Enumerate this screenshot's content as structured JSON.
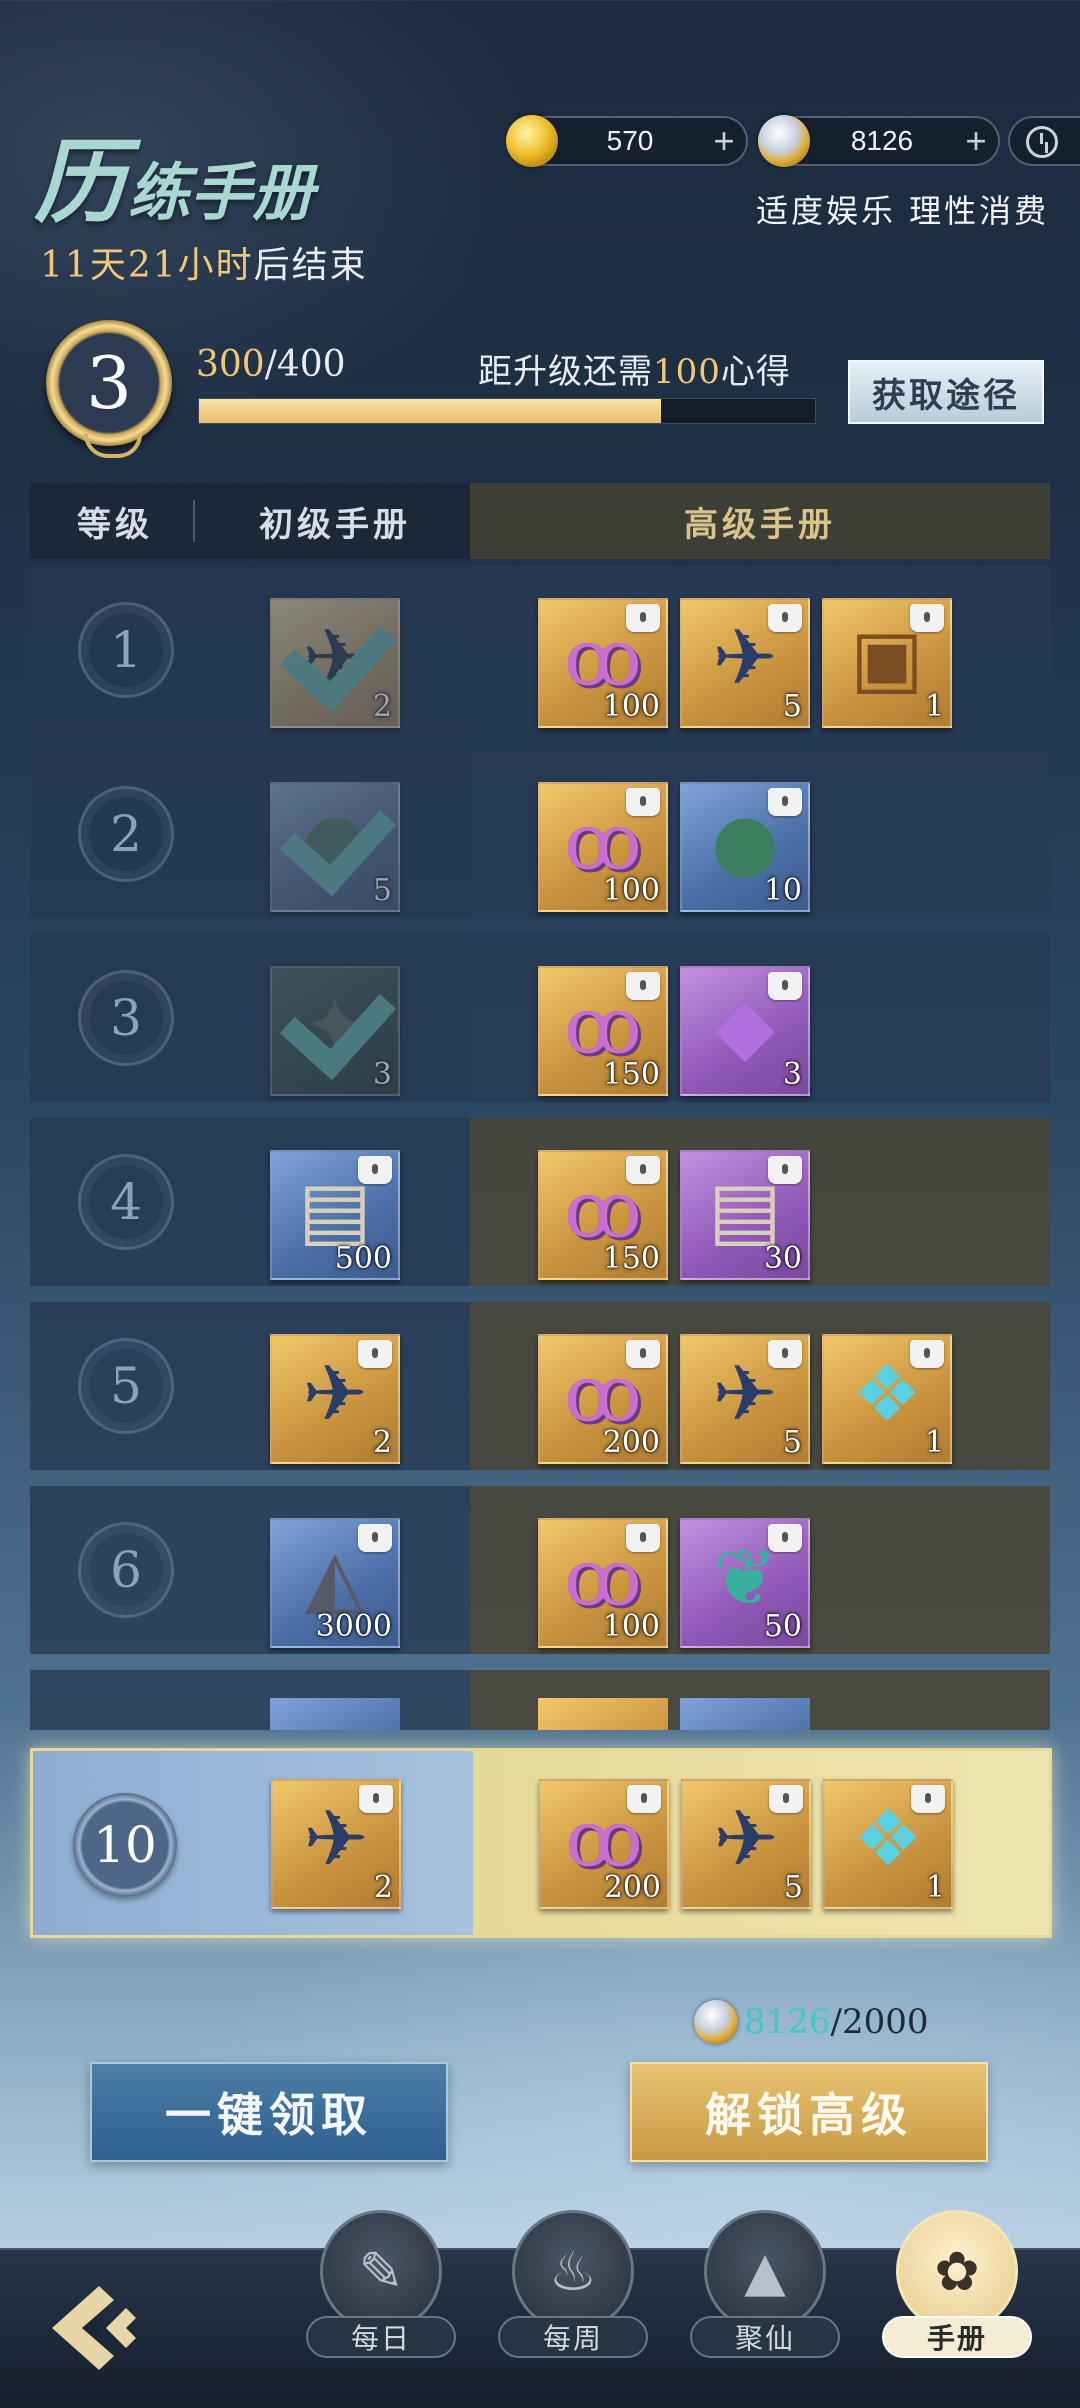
{
  "header": {
    "title_first": "历",
    "title_rest": "练手册",
    "countdown_days": "11",
    "countdown_days_unit": "天",
    "countdown_hours": "21",
    "countdown_hours_unit": "小时",
    "countdown_suffix": "后结束",
    "notice": "适度娱乐 理性消费"
  },
  "currencies": [
    {
      "icon": "gold-ingot-icon",
      "amount": "570",
      "plus": "+"
    },
    {
      "icon": "silver-gold-coin-icon",
      "amount": "8126",
      "plus": "+"
    }
  ],
  "progress": {
    "level": "3",
    "exp_current": "300",
    "exp_total": "/400",
    "need_prefix": "距升级还需",
    "need_amount": "100",
    "need_suffix": "心得",
    "fill_fraction": 0.75,
    "get_button": "获取途径"
  },
  "table_header": {
    "level": "等级",
    "basic": "初级手册",
    "advanced": "高级手册"
  },
  "rows": [
    {
      "level": "1",
      "claimed": true,
      "basic": [
        {
          "icon": "cannon-scroll-icon",
          "rarity": "gold",
          "count": "2",
          "claimed": true
        }
      ],
      "advanced": [
        {
          "icon": "spiral-token-icon",
          "rarity": "gold",
          "count": "100"
        },
        {
          "icon": "cannon-scroll-icon",
          "rarity": "gold",
          "count": "5"
        },
        {
          "icon": "treasure-chest-icon",
          "rarity": "gold",
          "count": "1"
        }
      ]
    },
    {
      "level": "2",
      "claimed": true,
      "basic": [
        {
          "icon": "herb-pouch-icon",
          "rarity": "blue",
          "count": "5",
          "claimed": true
        }
      ],
      "advanced": [
        {
          "icon": "spiral-token-icon",
          "rarity": "gold",
          "count": "100"
        },
        {
          "icon": "herb-pouch-icon",
          "rarity": "blue",
          "count": "10"
        }
      ]
    },
    {
      "level": "3",
      "claimed": true,
      "basic": [
        {
          "icon": "horn-icon",
          "rarity": "green",
          "count": "3",
          "claimed": true
        }
      ],
      "advanced": [
        {
          "icon": "spiral-token-icon",
          "rarity": "gold",
          "count": "150"
        },
        {
          "icon": "purple-crystal-icon",
          "rarity": "purple",
          "count": "3"
        }
      ]
    },
    {
      "level": "4",
      "claimed": false,
      "basic": [
        {
          "icon": "paper-scroll-icon",
          "rarity": "blue",
          "count": "500"
        }
      ],
      "advanced": [
        {
          "icon": "spiral-token-icon",
          "rarity": "gold",
          "count": "150"
        },
        {
          "icon": "paper-scroll-icon",
          "rarity": "purple",
          "count": "30"
        }
      ]
    },
    {
      "level": "5",
      "claimed": false,
      "basic": [
        {
          "icon": "cannon-scroll-icon",
          "rarity": "gold",
          "count": "2"
        }
      ],
      "advanced": [
        {
          "icon": "spiral-token-icon",
          "rarity": "gold",
          "count": "200"
        },
        {
          "icon": "cannon-scroll-icon",
          "rarity": "gold",
          "count": "5"
        },
        {
          "icon": "spirit-gem-icon",
          "rarity": "gold",
          "count": "1"
        }
      ]
    },
    {
      "level": "6",
      "claimed": false,
      "basic": [
        {
          "icon": "ore-rock-icon",
          "rarity": "blue",
          "count": "3000"
        }
      ],
      "advanced": [
        {
          "icon": "spiral-token-icon",
          "rarity": "gold",
          "count": "100"
        },
        {
          "icon": "jade-leaf-icon",
          "rarity": "purple",
          "count": "50"
        }
      ]
    }
  ],
  "highlight_row": {
    "level": "10",
    "basic": [
      {
        "icon": "cannon-scroll-icon",
        "rarity": "gold",
        "count": "2"
      }
    ],
    "advanced": [
      {
        "icon": "spiral-token-icon",
        "rarity": "gold",
        "count": "200"
      },
      {
        "icon": "cannon-scroll-icon",
        "rarity": "gold",
        "count": "5"
      },
      {
        "icon": "spirit-gem-icon",
        "rarity": "gold",
        "count": "1"
      }
    ]
  },
  "unlock_requirement": {
    "have": "8126",
    "need": "/2000"
  },
  "buttons": {
    "claim_all": "一键领取",
    "unlock_advanced": "解锁高级"
  },
  "tabs": [
    {
      "label": "每日",
      "icon": "daily-scroll-icon",
      "active": false
    },
    {
      "label": "每周",
      "icon": "weekly-book-icon",
      "active": false
    },
    {
      "label": "聚仙",
      "icon": "immortal-cards-icon",
      "active": false
    },
    {
      "label": "手册",
      "icon": "handbook-bag-icon",
      "active": true
    }
  ]
}
